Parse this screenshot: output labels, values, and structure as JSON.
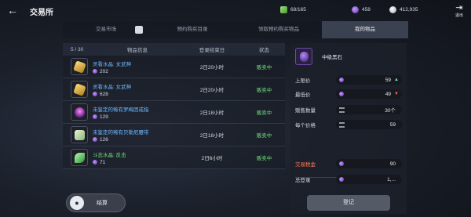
{
  "header": {
    "title": "交易所",
    "currencies": [
      {
        "icon": "green-gem-icon",
        "value": "68/165"
      },
      {
        "icon": "purple-crystal-icon",
        "value": "458"
      },
      {
        "icon": "silver-coin-icon",
        "value": "412,935"
      }
    ],
    "exit_label": "退出"
  },
  "tabs": [
    {
      "label": "交易市场"
    },
    {
      "label": "预约购买目录"
    },
    {
      "label": "领取预约购买物品"
    },
    {
      "label": "我的物品"
    }
  ],
  "list": {
    "columns": {
      "count": "5 / 30",
      "info": "物品信息",
      "time": "登录结束日",
      "status": "状态"
    },
    "rows": [
      {
        "name": "灵看水晶: 女武神",
        "price": "202",
        "time": "2日20小时",
        "status": "贩卖中",
        "icon": "gold-crystal-icon"
      },
      {
        "name": "灵看水晶: 女武神",
        "price": "628",
        "time": "2日20小时",
        "status": "贩卖中",
        "icon": "gold-crystal-icon"
      },
      {
        "name": "未鉴定的稀有罗梅因戒指",
        "price": "129",
        "time": "2日18小时",
        "status": "贩卖中",
        "icon": "ring-icon"
      },
      {
        "name": "未鉴定的稀有贝勒尼腰带",
        "price": "126",
        "time": "2日18小时",
        "status": "贩卖中",
        "icon": "belt-icon"
      },
      {
        "name": "斗志水晶: 反击",
        "price": "71",
        "time": "2日6小时",
        "status": "贩卖中",
        "icon": "green-crystal-icon"
      }
    ]
  },
  "settle_button": {
    "label": "结算"
  },
  "detail": {
    "item_name": "中级黑石",
    "upper_price": {
      "label": "上限价",
      "value": "59"
    },
    "lowest_price": {
      "label": "最低价",
      "value": "49"
    },
    "sell_qty": {
      "label": "贩售数量",
      "value": "30个"
    },
    "unit_price": {
      "label": "每个价格",
      "value": "59"
    },
    "tax": {
      "label": "交易税金",
      "value": "90"
    },
    "total": {
      "label": "总登录",
      "value": "1,..."
    },
    "register_label": "登记"
  },
  "colors": {
    "status_green": "#6fe07a",
    "item_blue": "#6fb7ff",
    "tax_red": "#ff7a5a"
  }
}
